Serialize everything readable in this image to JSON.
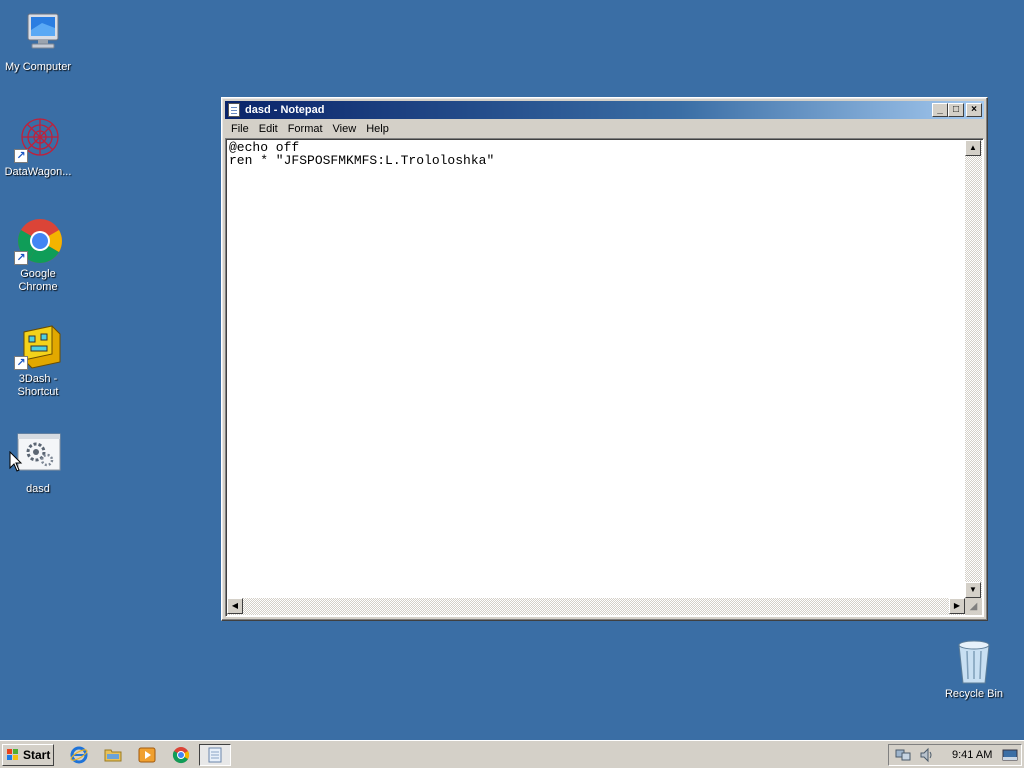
{
  "desktop": {
    "icons": [
      {
        "label": "My Computer",
        "icon": "my-computer-icon"
      },
      {
        "label": "DataWagon...",
        "icon": "datawagon-icon"
      },
      {
        "label": "Google Chrome",
        "icon": "chrome-icon"
      },
      {
        "label": "3Dash - Shortcut",
        "icon": "3dash-icon"
      },
      {
        "label": "dasd",
        "icon": "batch-file-icon"
      },
      {
        "label": "Recycle Bin",
        "icon": "recycle-bin-icon"
      }
    ],
    "background_color": "#3a6ea5"
  },
  "notepad": {
    "title": "dasd - Notepad",
    "menu": [
      "File",
      "Edit",
      "Format",
      "View",
      "Help"
    ],
    "content": "@echo off\nren * \"JFSPOSFMKMFS:L.Trololoshka\""
  },
  "taskbar": {
    "start_label": "Start",
    "clock": "9:41 AM"
  }
}
